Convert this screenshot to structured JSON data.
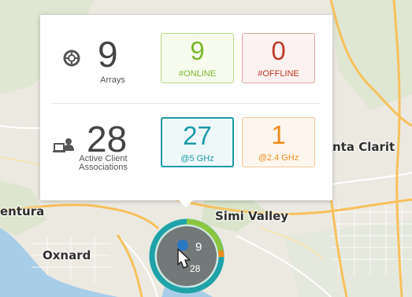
{
  "map": {
    "places": [
      {
        "id": "santa-clarita",
        "label": "nta Clarit"
      },
      {
        "id": "ventura",
        "label": "entura"
      },
      {
        "id": "simi-valley",
        "label": "Simi Valley"
      },
      {
        "id": "oxnard",
        "label": "Oxnard"
      }
    ],
    "colors": {
      "land": "#ece9e1",
      "water": "#a8cde8",
      "green": "#d5e3c5",
      "highway": "#f6c15c",
      "road": "#ffffff"
    }
  },
  "popup": {
    "arrays": {
      "icon": "array-icon",
      "count": "9",
      "label": "Arrays",
      "online": {
        "value": "9",
        "label": "#ONLINE",
        "color": "#7cb82f"
      },
      "offline": {
        "value": "0",
        "label": "#OFFLINE",
        "color": "#c0392b"
      }
    },
    "clients": {
      "icon": "client-user-icon",
      "count": "28",
      "label_line1": "Active Client",
      "label_line2": "Associations",
      "ghz5": {
        "value": "27",
        "label": "@5 GHz",
        "color": "#1e9aa8"
      },
      "ghz24": {
        "value": "1",
        "label": "@2.4 GHz",
        "color": "#f08c1e"
      }
    }
  },
  "cluster": {
    "arrays_count": "9",
    "clients_count": "28",
    "ring_colors": [
      "#1fa2a8",
      "#8cc63f",
      "#f08c1e"
    ],
    "icon": "hand-cursor-icon"
  }
}
